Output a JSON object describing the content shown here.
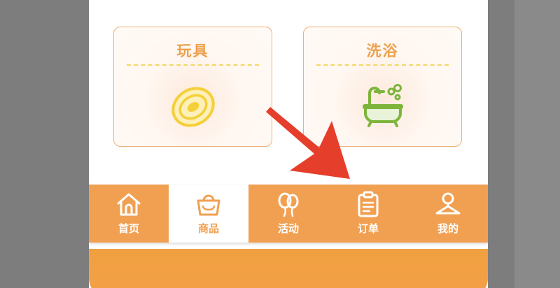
{
  "categories": [
    {
      "label": "玩具",
      "icon": "frisbee-icon"
    },
    {
      "label": "洗浴",
      "icon": "bathtub-icon"
    }
  ],
  "nav": {
    "items": [
      {
        "label": "首页",
        "icon": "home-icon",
        "active": false
      },
      {
        "label": "商品",
        "icon": "shopping-bag-icon",
        "active": true
      },
      {
        "label": "活动",
        "icon": "balloon-icon",
        "active": false
      },
      {
        "label": "订单",
        "icon": "clipboard-icon",
        "active": false
      },
      {
        "label": "我的",
        "icon": "user-icon",
        "active": false
      }
    ]
  },
  "colors": {
    "accent": "#f1a052",
    "arrow": "#e53e2b",
    "card_border": "#eeb07a",
    "divider": "#f3d766",
    "toy_icon": "#f5cf3a",
    "bath_icon": "#7db53b"
  }
}
